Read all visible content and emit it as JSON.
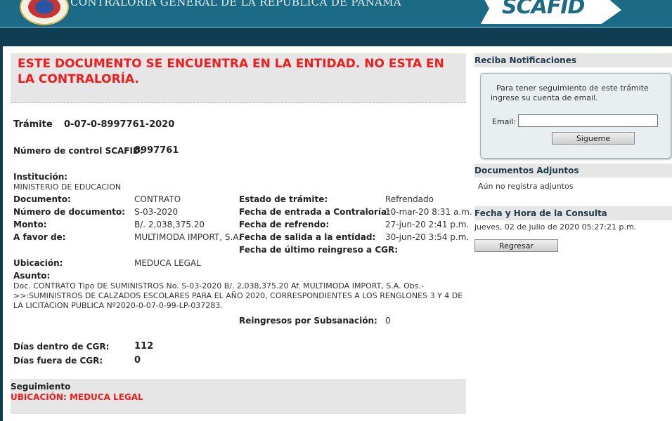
{
  "header": {
    "title": "CONTRALORÍA GENERAL DE LA REPÚBLICA DE PANAMÁ",
    "logo_text": "SCAFID"
  },
  "alert": {
    "text": "ESTE DOCUMENTO SE ENCUENTRA EN LA ENTIDAD. NO ESTA EN LA CONTRALORÍA."
  },
  "tramite": {
    "label": "Trámite",
    "value": "0-07-0-8997761-2020"
  },
  "control": {
    "label": "Número de control SCAFID:",
    "value": "8997761"
  },
  "institucion": {
    "label": "Institución:",
    "value": "MINISTERIO DE EDUCACION"
  },
  "left_fields": [
    {
      "label": "Documento:",
      "value": "CONTRATO"
    },
    {
      "label": "Número de documento:",
      "value": "S-03-2020"
    },
    {
      "label": "Monto:",
      "value": "B/. 2,038,375.20"
    },
    {
      "label": "A favor de:",
      "value": "MULTIMODA IMPORT, S.A."
    }
  ],
  "right_fields": [
    {
      "label": "Estado de trámite:",
      "value": "Refrendado"
    },
    {
      "label": "Fecha de entrada a Contraloría:",
      "value": "10-mar-20 8:31 a.m."
    },
    {
      "label": "Fecha de refrendo:",
      "value": "27-jun-20 2:41 p.m."
    },
    {
      "label": "Fecha de salida a la entidad:",
      "value": "30-jun-20 3:54 p.m."
    },
    {
      "label": "Fecha de último reingreso a CGR:",
      "value": "-"
    }
  ],
  "ubicacion": {
    "label": "Ubicación:",
    "value": "MEDUCA LEGAL"
  },
  "asunto": {
    "label": "Asunto:",
    "value": "Doc. CONTRATO Tipo DE SUMINISTROS No. S-03-2020 B/. 2,038,375.20 Af. MULTIMODA IMPORT, S.A. Obs.->>:SUMINISTROS DE CALZADOS ESCOLARES PARA EL AÑO 2020, CORRESPONDIENTES A LOS RENGLONES 3 Y 4 DE LA LICITACION PUBLICA Nº2020-0-07-0-99-LP-037283."
  },
  "reingresos": {
    "label": "Reingresos por Subsanación:",
    "value": "0"
  },
  "dias_dentro": {
    "label": "Días dentro de CGR:",
    "value": "112"
  },
  "dias_fuera": {
    "label": "Días fuera de CGR:",
    "value": "0"
  },
  "seguimiento": {
    "title": "Seguimiento",
    "ubicacion": "UBICACIÓN: MEDUCA LEGAL"
  },
  "sidebar": {
    "notif_title": "Reciba Notificaciones",
    "notif_text": "Para tener seguimiento de este trámite ingrese su cuenta de email.",
    "email_label": "Email:",
    "email_value": "",
    "follow_button": "Sigueme",
    "docs_title": "Documentos Adjuntos",
    "docs_text": "Aún no registra adjuntos",
    "fecha_title": "Fecha y Hora de la Consulta",
    "fecha_text": "jueves, 02 de julio de 2020 05:27:21 p.m.",
    "back_button": "Regresar"
  },
  "colors": {
    "header": "#1b6a86",
    "bar": "#0f3e52",
    "alert_red": "#ee1c1c",
    "panel_gray": "#e6e6e6"
  }
}
